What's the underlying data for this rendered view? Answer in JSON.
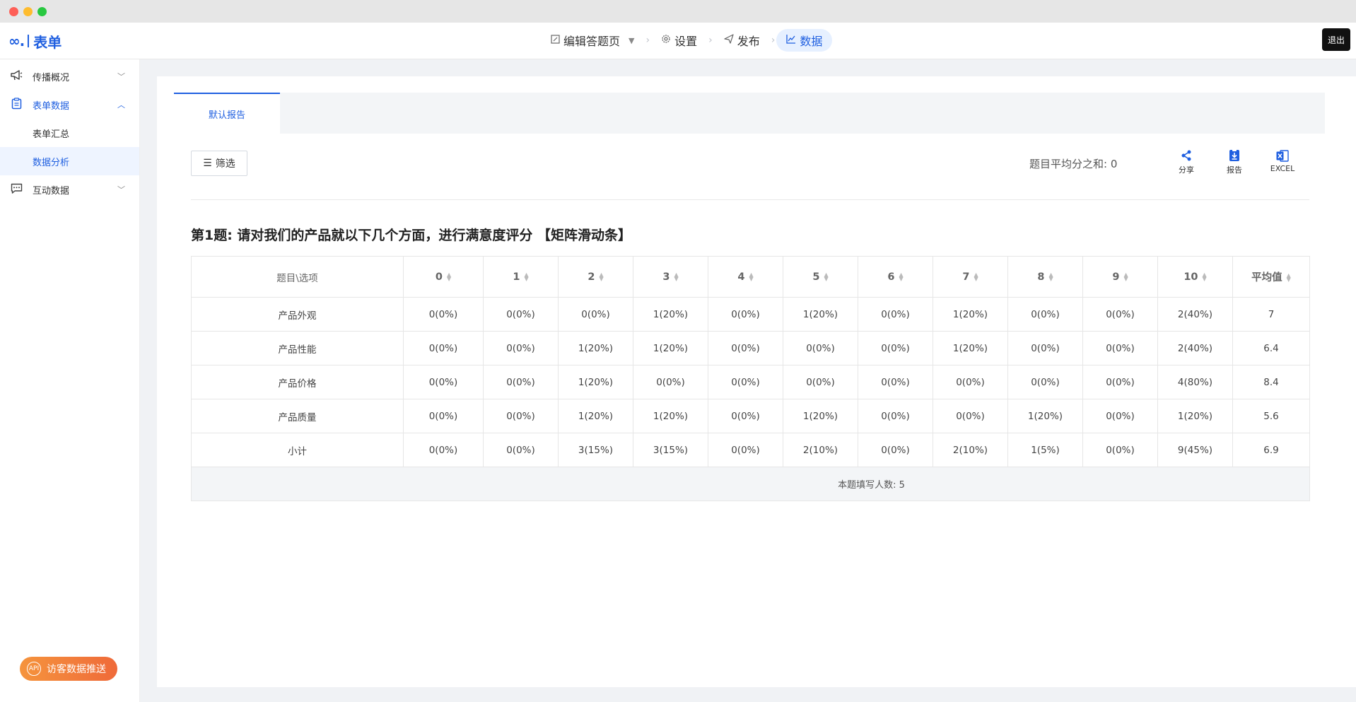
{
  "topnav": {
    "logo_text": "表单",
    "steps": [
      {
        "label": "编辑答题页",
        "icon": "edit-icon"
      },
      {
        "label": "设置",
        "icon": "gear-icon"
      },
      {
        "label": "发布",
        "icon": "send-icon"
      },
      {
        "label": "数据",
        "icon": "chart-line-icon"
      }
    ],
    "logout_label": "退出"
  },
  "sidebar": {
    "items": [
      {
        "label": "传播概况",
        "icon": "megaphone-icon"
      },
      {
        "label": "表单数据",
        "icon": "clipboard-icon"
      },
      {
        "label": "表单汇总"
      },
      {
        "label": "数据分析"
      },
      {
        "label": "互动数据",
        "icon": "chat-icon"
      }
    ],
    "visitor_button": "访客数据推送"
  },
  "main": {
    "tab_label": "默认报告",
    "filter_label": "筛选",
    "avg_sum_label": "题目平均分之和:",
    "avg_sum_value": "0",
    "actions": [
      {
        "label": "分享",
        "icon": "share-icon"
      },
      {
        "label": "报告",
        "icon": "download-report-icon"
      },
      {
        "label": "EXCEL",
        "icon": "excel-icon"
      }
    ],
    "question_title": "第1题: 请对我们的产品就以下几个方面，进行满意度评分 【矩阵滑动条】",
    "table": {
      "corner_header": "题目\\选项",
      "headers": [
        "0",
        "1",
        "2",
        "3",
        "4",
        "5",
        "6",
        "7",
        "8",
        "9",
        "10",
        "平均值"
      ],
      "rows": [
        {
          "name": "产品外观",
          "cells": [
            "0(0%)",
            "0(0%)",
            "0(0%)",
            "1(20%)",
            "0(0%)",
            "1(20%)",
            "0(0%)",
            "1(20%)",
            "0(0%)",
            "0(0%)",
            "2(40%)",
            "7"
          ]
        },
        {
          "name": "产品性能",
          "cells": [
            "0(0%)",
            "0(0%)",
            "1(20%)",
            "1(20%)",
            "0(0%)",
            "0(0%)",
            "0(0%)",
            "1(20%)",
            "0(0%)",
            "0(0%)",
            "2(40%)",
            "6.4"
          ]
        },
        {
          "name": "产品价格",
          "cells": [
            "0(0%)",
            "0(0%)",
            "1(20%)",
            "0(0%)",
            "0(0%)",
            "0(0%)",
            "0(0%)",
            "0(0%)",
            "0(0%)",
            "0(0%)",
            "4(80%)",
            "8.4"
          ]
        },
        {
          "name": "产品质量",
          "cells": [
            "0(0%)",
            "0(0%)",
            "1(20%)",
            "1(20%)",
            "0(0%)",
            "1(20%)",
            "0(0%)",
            "0(0%)",
            "1(20%)",
            "0(0%)",
            "1(20%)",
            "5.6"
          ]
        },
        {
          "name": "小计",
          "cells": [
            "0(0%)",
            "0(0%)",
            "3(15%)",
            "3(15%)",
            "0(0%)",
            "2(10%)",
            "0(0%)",
            "2(10%)",
            "1(5%)",
            "0(0%)",
            "9(45%)",
            "6.9"
          ]
        }
      ],
      "footer": "本题填写人数: 5"
    }
  },
  "colors": {
    "accent": "#1f5fe0",
    "visitor_gradient_start": "#f5943d",
    "visitor_gradient_end": "#ef6a3a"
  }
}
